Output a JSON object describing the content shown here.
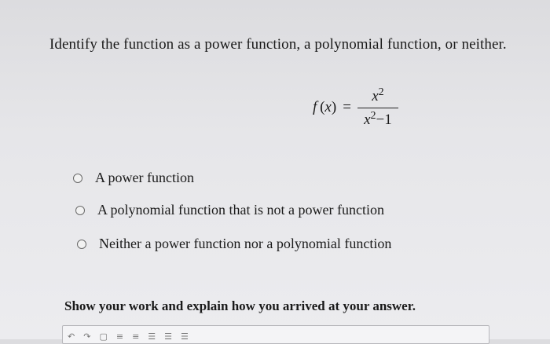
{
  "question": {
    "text": "Identify the function as a power function, a polynomial function, or neither."
  },
  "equation": {
    "lhs_name": "f",
    "lhs_var": "x",
    "equals": "=",
    "numerator_base": "x",
    "numerator_exp": "2",
    "denominator_base": "x",
    "denominator_exp": "2",
    "denominator_rest": "−1"
  },
  "options": [
    {
      "label": "A power function",
      "selected": false
    },
    {
      "label": "A polynomial function that is not a power function",
      "selected": false
    },
    {
      "label": "Neither a power function nor a polynomial function",
      "selected": false
    }
  ],
  "instruction": {
    "text": "Show your work and explain how you arrived at your answer."
  },
  "editor": {
    "toolbar_icons": [
      "undo-icon",
      "redo-icon",
      "image-icon",
      "bullet-list-icon",
      "numbered-list-icon",
      "align-left-icon",
      "align-center-icon",
      "align-right-icon"
    ]
  }
}
